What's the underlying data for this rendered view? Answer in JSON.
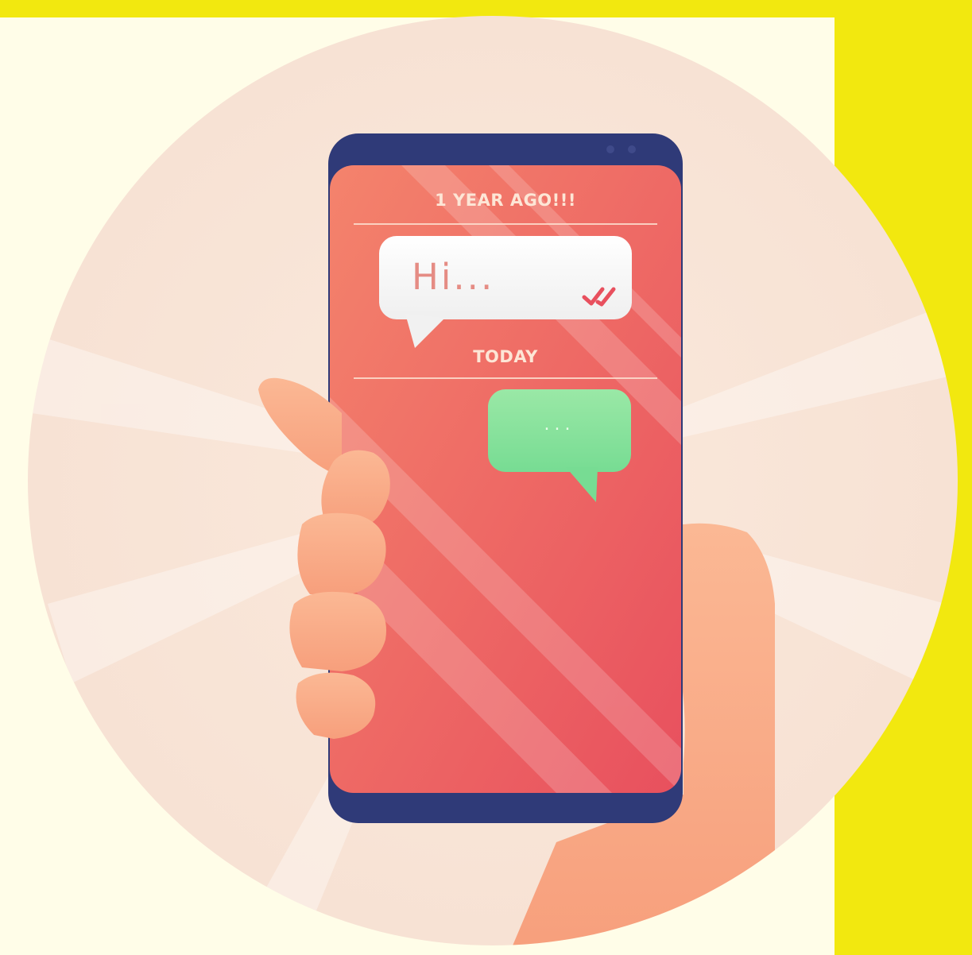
{
  "chat": {
    "date_separator_1": "1 YEAR AGO!!!",
    "sent_message": "Hi...",
    "date_separator_2": "TODAY",
    "typing_indicator": "..."
  },
  "colors": {
    "background_yellow": "#f2e80f",
    "panel_cream": "#fffde8",
    "phone_frame": "#2f3a78",
    "screen_red": "#f06a5e",
    "bubble_white": "#ffffff",
    "bubble_green": "#86e3a0",
    "hand_skin": "#f9a985"
  },
  "icons": {
    "read_receipt": "double-check-icon"
  }
}
